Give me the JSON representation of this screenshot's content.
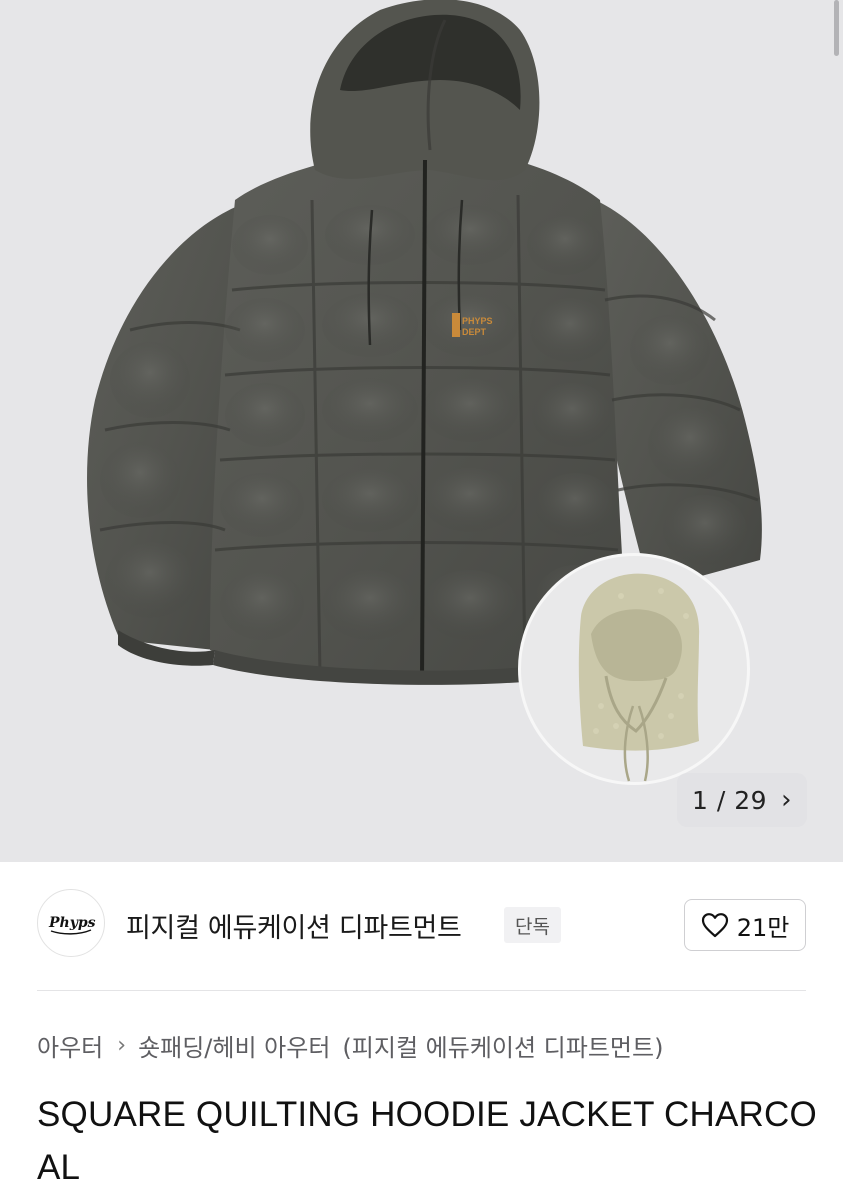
{
  "gallery": {
    "current": "1",
    "separator": "/",
    "total": "29",
    "next_icon": "chevron-right-icon",
    "jacket_logo_text": "PHYPS DEPT"
  },
  "brand": {
    "logo_text": "Phyps",
    "name": "피지컬 에듀케이션 디파트먼트",
    "badge": "단독",
    "like_icon": "heart-outline-icon",
    "like_count": "21만"
  },
  "breadcrumb": {
    "category": "아우터",
    "subcategory": "숏패딩/헤비 아우터",
    "brand_ref": "(피지컬 에듀케이션 디파트먼트)"
  },
  "product": {
    "title": "SQUARE QUILTING HOODIE JACKET CHARCOAL"
  },
  "colors": {
    "hero_background": "#e6e6e8",
    "jacket": "#555651",
    "accent_logo": "#c98a3a",
    "hood_accessory": "#c9c6a8"
  }
}
